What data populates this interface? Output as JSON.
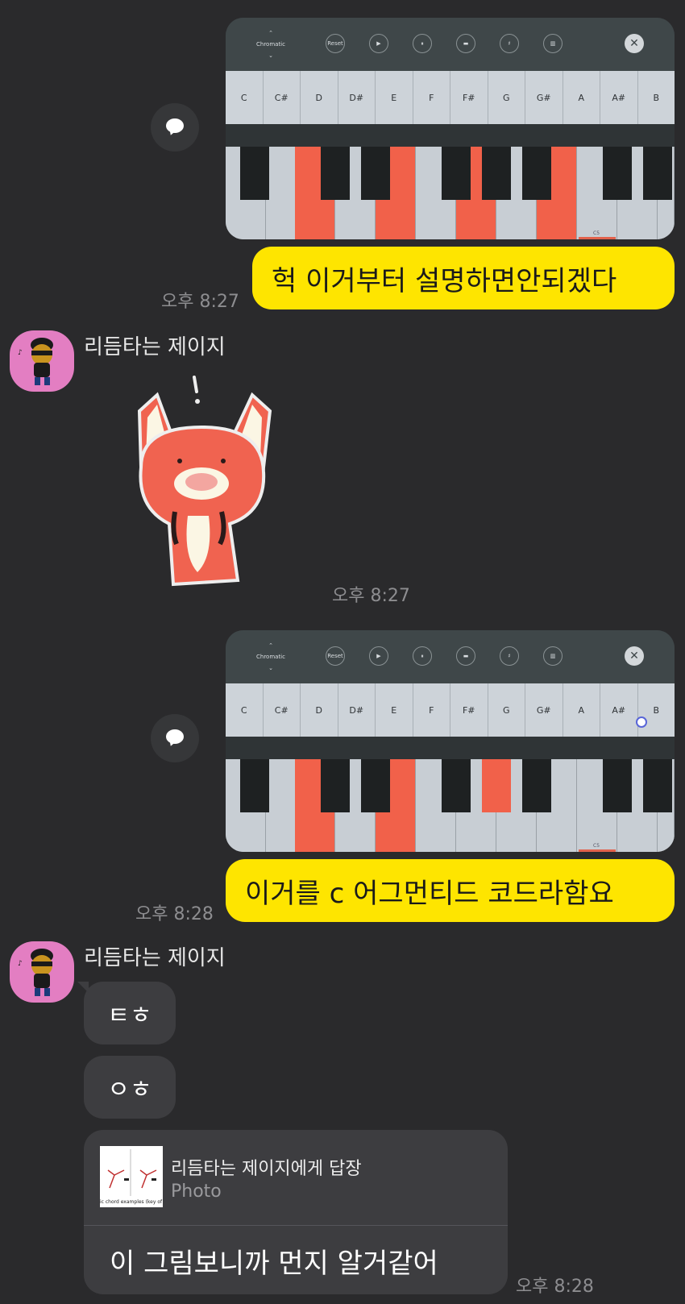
{
  "piano_app": {
    "mode_label": "Chromatic",
    "reset_label": "Reset",
    "play_icon": "▶",
    "pause_icon": "⏸",
    "loop_icon": "▬",
    "sharp_icon": "♯",
    "bars_icon": "▥",
    "close_icon": "✕",
    "notes": [
      "C",
      "C#",
      "D",
      "D#",
      "E",
      "F",
      "F#",
      "G",
      "G#",
      "A",
      "A#",
      "B"
    ],
    "octave_marker": "C5",
    "highlight_color": "#f1614a"
  },
  "messages": {
    "m1": {
      "text": "헉 이거부터 설명하면안되겠다",
      "time": "오후 8:27"
    },
    "m2": {
      "sender": "리듬타는 제이지",
      "time": "오후 8:27"
    },
    "m3": {
      "text": "이거를 c 어그먼티드 코드라함요",
      "time": "오후 8:28"
    },
    "m4": {
      "sender": "리듬타는 제이지",
      "bubble1": "ㅌㅎ",
      "bubble2": "ㅇㅎ",
      "reply_to": "리듬타는 제이지에게 답장",
      "reply_type": "Photo",
      "thumb_caption": "ic chord examples (key of",
      "text": "이 그림보니까 먼지 알거같어",
      "time": "오후 8:28"
    }
  },
  "colors": {
    "background": "#2a2a2c",
    "my_bubble": "#fee500",
    "their_bubble": "#3d3d40",
    "avatar_bg": "#e37ec2"
  }
}
